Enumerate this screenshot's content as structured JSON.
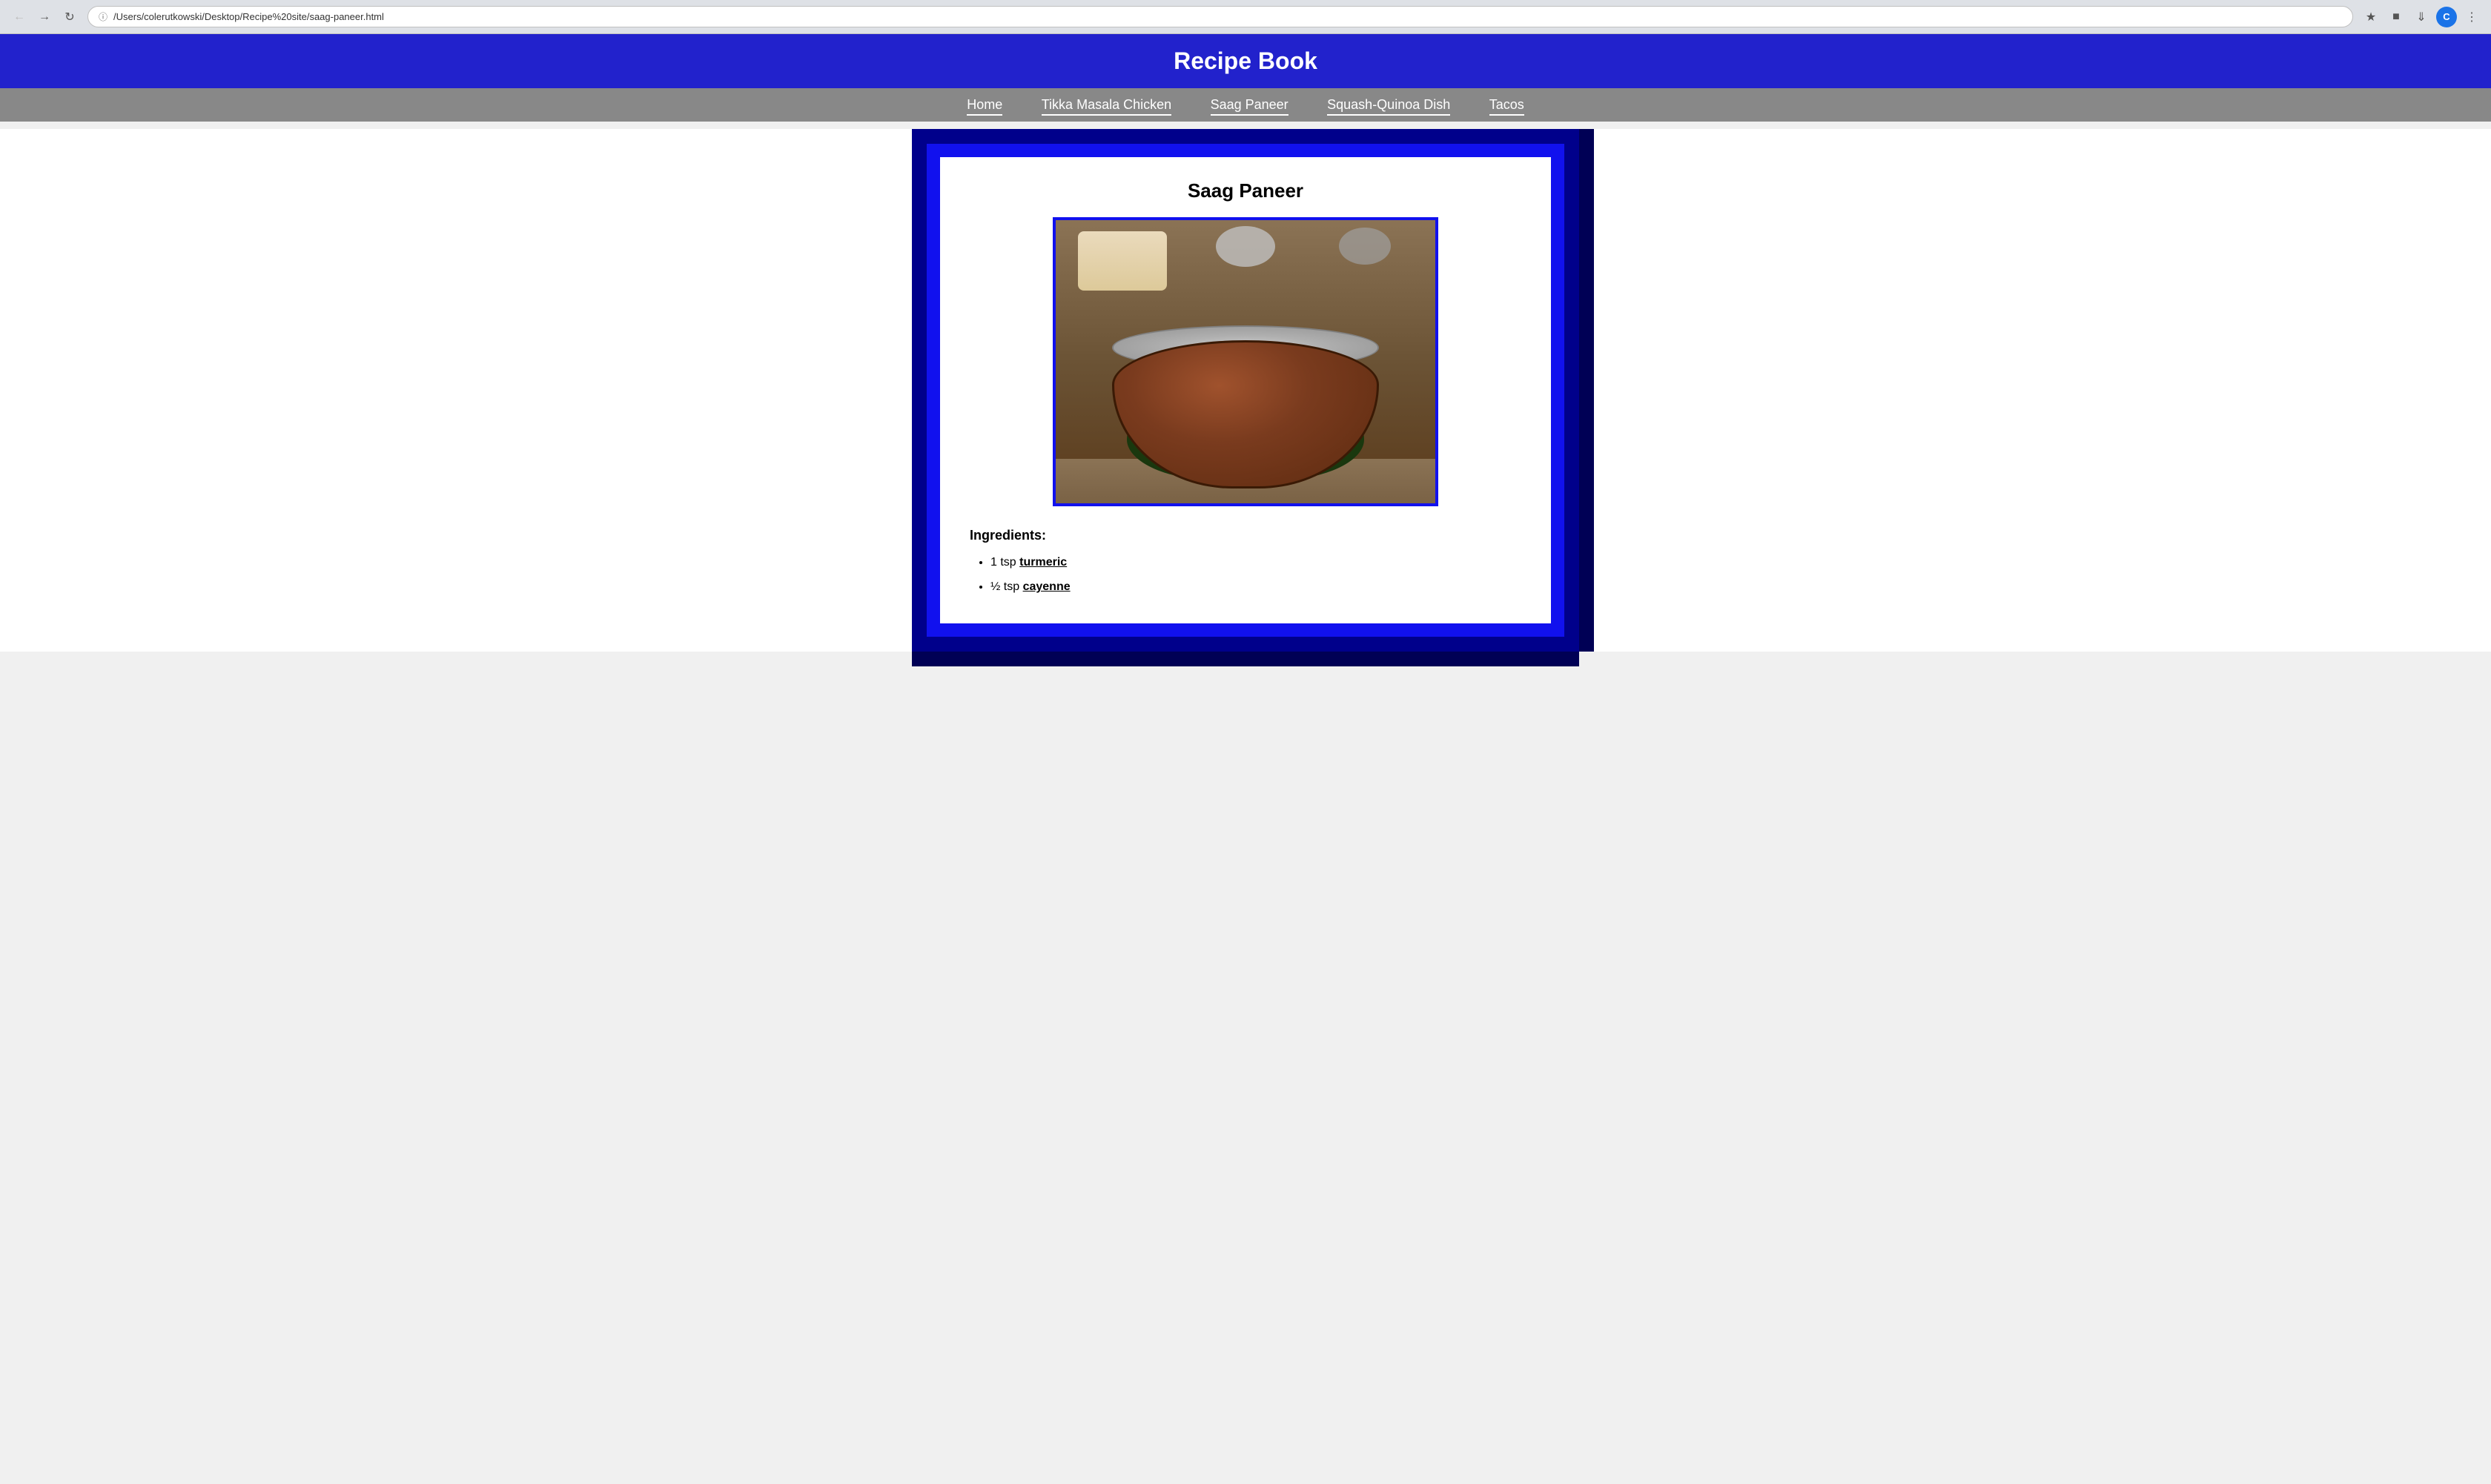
{
  "browser": {
    "address": "/Users/colerutkowski/Desktop/Recipe%20site/saag-paneer.html",
    "back_label": "←",
    "forward_label": "→",
    "reload_label": "↻",
    "info_icon": "ℹ",
    "star_icon": "☆",
    "download_icon": "⬇",
    "menu_icon": "⋮",
    "avatar_label": "C"
  },
  "header": {
    "title": "Recipe Book"
  },
  "nav": {
    "items": [
      {
        "label": "Home",
        "href": "#"
      },
      {
        "label": "Tikka Masala Chicken",
        "href": "#"
      },
      {
        "label": "Saag Paneer",
        "href": "#"
      },
      {
        "label": "Squash-Quinoa Dish",
        "href": "#"
      },
      {
        "label": "Tacos",
        "href": "#"
      }
    ]
  },
  "recipe": {
    "title": "Saag Paneer",
    "image_alt": "Saag Paneer dish in a copper karahi",
    "ingredients_heading": "Ingredients:",
    "ingredients": [
      {
        "text": "1 tsp ",
        "link": "turmeric",
        "link_text": "turmeric"
      },
      {
        "text": "½ tsp ",
        "link": "cayenne",
        "link_text": "cayenne"
      }
    ]
  }
}
